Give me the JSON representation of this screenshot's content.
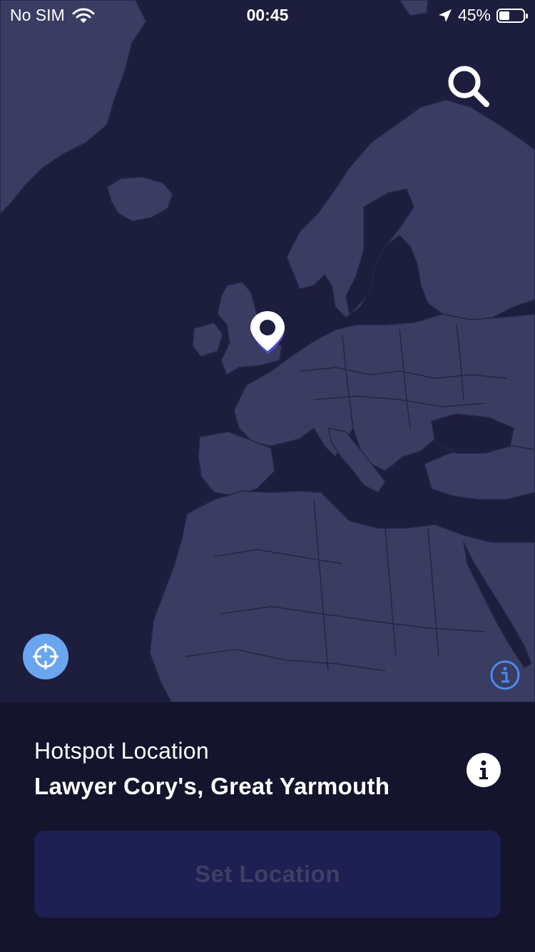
{
  "status_bar": {
    "carrier": "No SIM",
    "time": "00:45",
    "battery_percent": "45%",
    "battery_level": 0.45,
    "icons": [
      "wifi-icon",
      "location-arrow-icon",
      "battery-icon"
    ]
  },
  "map": {
    "icons": [
      "search-icon",
      "crosshair-icon",
      "info-icon",
      "location-pin-icon"
    ]
  },
  "panel": {
    "label": "Hotspot Location",
    "location_name": "Lawyer Cory's, Great Yarmouth",
    "set_button_label": "Set Location"
  },
  "colors": {
    "ocean": "#1d1d3d",
    "land": "#3b3c62",
    "borders": "#23233f",
    "panel_bg": "#14142d",
    "accent_blue": "#6aa6f0",
    "info_blue": "#4a8af0",
    "button_bg": "#1e1f52",
    "button_text_disabled": "#3e3f66"
  }
}
